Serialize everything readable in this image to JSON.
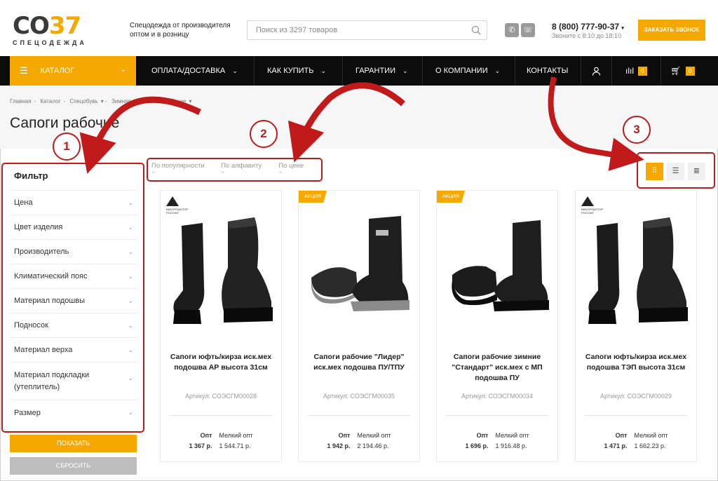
{
  "header": {
    "logo_main": "СО",
    "logo_accent": "37",
    "logo_sub": "СПЕЦОДЕЖДА",
    "tagline": "Спецодежда от производителя оптом и в розницу",
    "search_placeholder": "Поиск из 3297 товаров",
    "phone": "8 (800) 777-90-37",
    "phone_hours": "Звоните с 8:10 до 18:10",
    "callback_label": "ЗАКАЗАТЬ ЗВОНОК"
  },
  "nav": {
    "catalog": "КАТАЛОГ",
    "items": [
      "ОПЛАТА/ДОСТАВКА",
      "КАК КУПИТЬ",
      "ГАРАНТИИ",
      "О КОМПАНИИ",
      "КОНТАКТЫ"
    ],
    "compare_count": "0",
    "cart_count": "0"
  },
  "breadcrumb": [
    "Главная",
    "Каталог",
    "Спецобувь",
    "Зимняя",
    "Сапоги рабочие"
  ],
  "page_title": "Сапоги рабочие",
  "filter": {
    "title": "Фильтр",
    "items": [
      "Цена",
      "Цвет изделия",
      "Производитель",
      "Климатический пояс",
      "Материал подошвы",
      "Подносок",
      "Материал верха",
      "Материал подкладки (утеплитель)",
      "Размер"
    ],
    "show_label": "ПОКАЗАТЬ",
    "reset_label": "СБРОСИТЬ"
  },
  "sort": [
    "По популярности",
    "По алфавиту",
    "По цене"
  ],
  "products": [
    {
      "badge": "",
      "maker": "ВИКОРОМОТОР РОССИИ",
      "name": "Сапоги юфть/кирза иск.мех подошва АР высота 31см",
      "sku": "Артикул: СОЭСГМ00028",
      "opt_label": "Опт",
      "small_label": "Мелкий опт",
      "opt_price": "1 367 р.",
      "small_price": "1 544.71 р."
    },
    {
      "badge": "АКЦИЯ",
      "maker": "",
      "name": "Сапоги рабочие \"Лидер\" иск.мех подошва ПУ/ТПУ",
      "sku": "Артикул: СОЭСГМ00035",
      "opt_label": "Опт",
      "small_label": "Мелкий опт",
      "opt_price": "1 942 р.",
      "small_price": "2 194.46 р."
    },
    {
      "badge": "АКЦИЯ",
      "maker": "",
      "name": "Сапоги рабочие зимние \"Стандарт\" иск.мех с МП подошва ПУ",
      "sku": "Артикул: СОЭСГМ00034",
      "opt_label": "Опт",
      "small_label": "Мелкий опт",
      "opt_price": "1 696 р.",
      "small_price": "1 916.48 р."
    },
    {
      "badge": "",
      "maker": "ВИКОРОМОТОР РОССИИ",
      "name": "Сапоги юфть/кирза иск.мех подошва ТЭП высота 31см",
      "sku": "Артикул: СОЭСГМ00029",
      "opt_label": "Опт",
      "small_label": "Мелкий опт",
      "opt_price": "1 471 р.",
      "small_price": "1 662.23 р."
    }
  ],
  "annotations": [
    "1",
    "2",
    "3"
  ],
  "colors": {
    "accent": "#f5a800",
    "nav_bg": "#0c0c0c",
    "annotation": "#c01a1a"
  },
  "icons": [
    "search-icon",
    "viber-icon",
    "whatsapp-icon",
    "menu-icon",
    "chevron-down-icon",
    "user-icon",
    "compare-icon",
    "cart-icon",
    "grid-view-icon",
    "list-view-icon",
    "table-view-icon"
  ]
}
